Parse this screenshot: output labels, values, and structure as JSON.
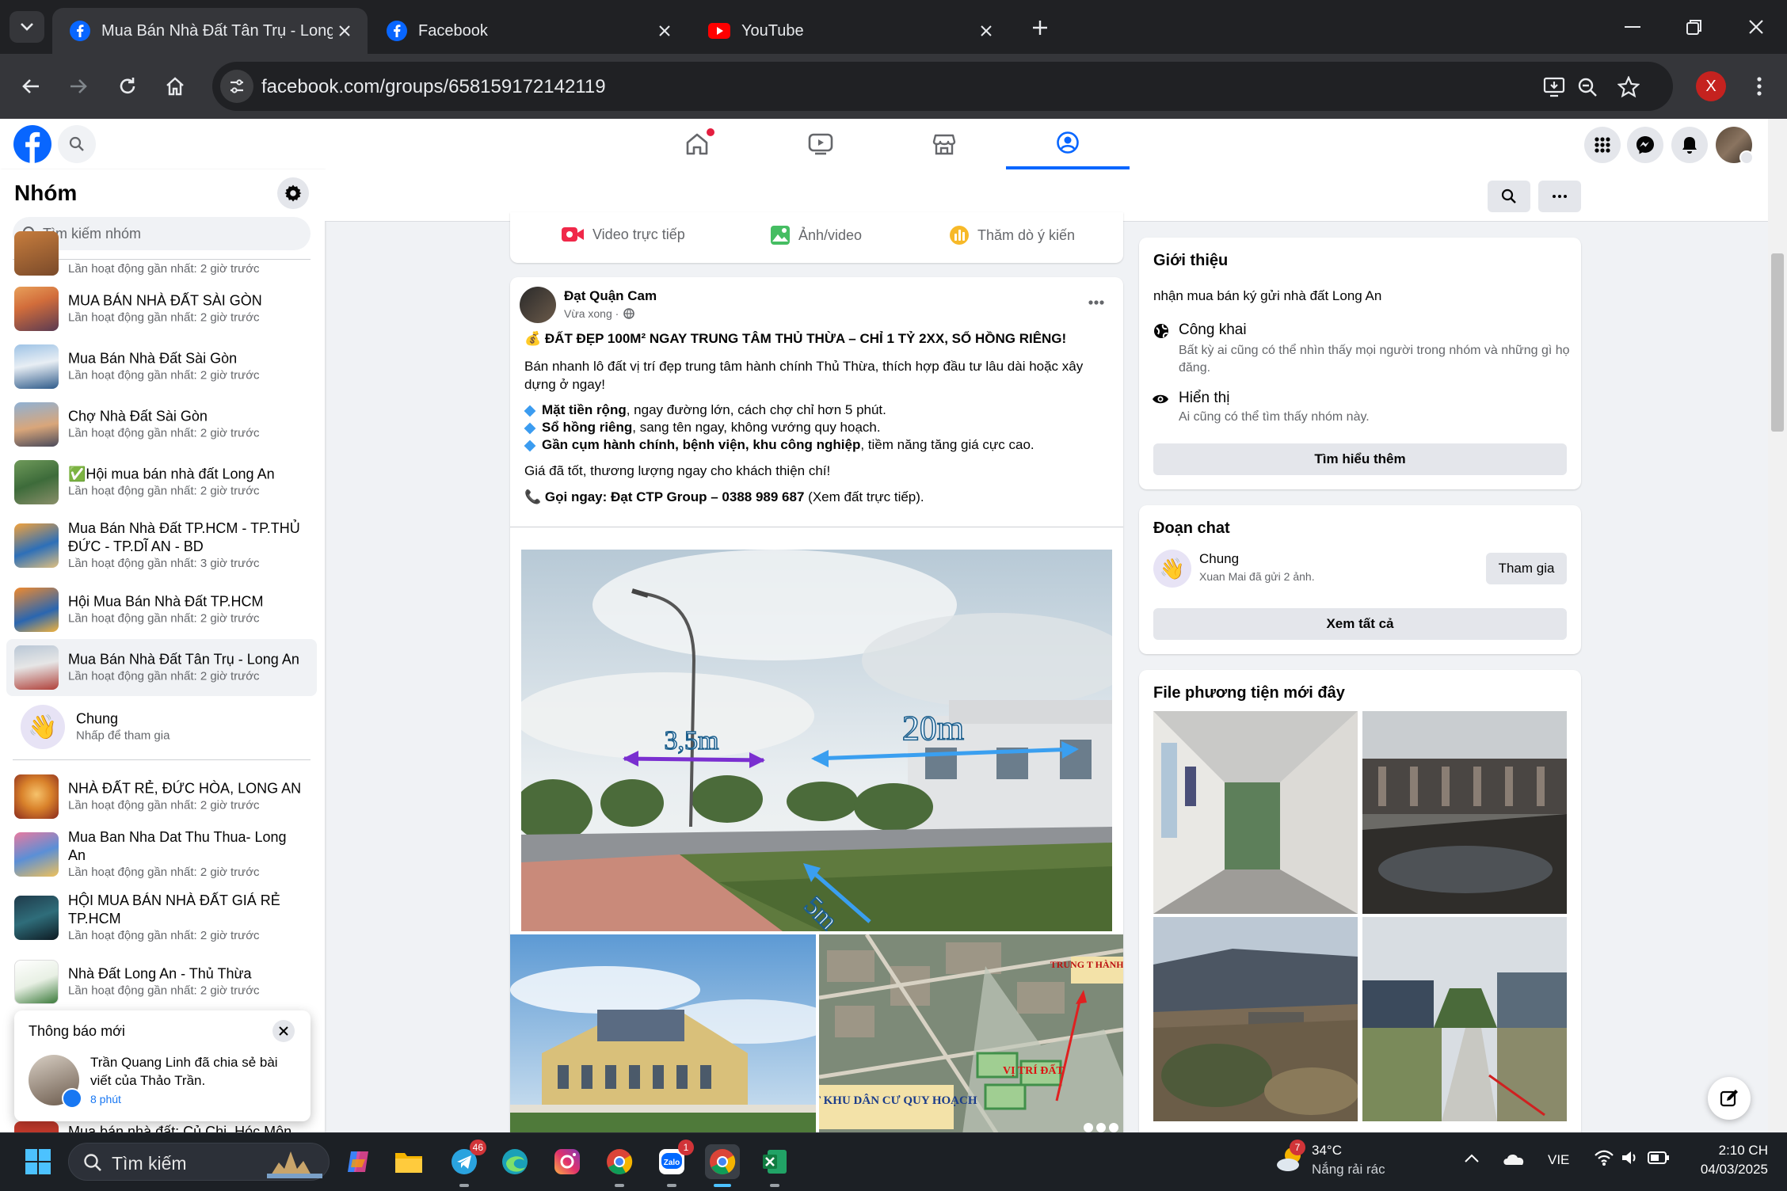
{
  "browser": {
    "tabs": [
      {
        "title": "Mua Bán Nhà Đất Tân Trụ - Long A",
        "active": true,
        "icon": "facebook-icon"
      },
      {
        "title": "Facebook",
        "active": false,
        "icon": "facebook-icon"
      },
      {
        "title": "YouTube",
        "active": false,
        "icon": "youtube-icon"
      }
    ],
    "url": "facebook.com/groups/658159172142119",
    "profile_initial": "X"
  },
  "sidebar": {
    "title": "Nhóm",
    "search_placeholder": "Tìm kiếm nhóm",
    "top_partial_activity": "Lần hoạt động gần nhất: 2 giờ trước",
    "groups": [
      {
        "name": "MUA BÁN NHÀ ĐẤT SÀI GÒN",
        "activity": "Lần hoạt động gần nhất: 2 giờ trước"
      },
      {
        "name": "Mua Bán Nhà Đất Sài Gòn",
        "activity": "Lần hoạt động gần nhất: 2 giờ trước"
      },
      {
        "name": "Chợ Nhà Đất Sài Gòn",
        "activity": "Lần hoạt động gần nhất: 2 giờ trước"
      },
      {
        "name": "✅Hội mua bán nhà đất Long An",
        "activity": "Lần hoạt động gần nhất: 2 giờ trước"
      },
      {
        "name": "Mua Bán Nhà Đất TP.HCM - TP.THỦ ĐỨC - TP.DĨ AN - BD",
        "activity": "Lần hoạt động gần nhất: 3 giờ trước"
      },
      {
        "name": "Hội Mua Bán Nhà Đất TP.HCM",
        "activity": "Lần hoạt động gần nhất: 2 giờ trước"
      },
      {
        "name": "Mua Bán Nhà Đất Tân Trụ - Long An",
        "activity": "Lần hoạt động gần nhất: 2 giờ trước"
      }
    ],
    "chat": {
      "name": "Chung",
      "hint": "Nhấp để tham gia"
    },
    "groups2": [
      {
        "name": "NHÀ ĐẤT RẺ, ĐỨC HÒA, LONG AN",
        "activity": "Lần hoạt động gần nhất: 2 giờ trước"
      },
      {
        "name": "Mua Ban Nha Dat Thu Thua- Long An",
        "activity": "Lần hoạt động gần nhất: 2 giờ trước"
      },
      {
        "name": "HỘI MUA BÁN NHÀ ĐẤT GIÁ RẺ TP.HCM",
        "activity": "Lần hoạt động gần nhất: 2 giờ trước"
      },
      {
        "name": "Nhà Đất Long An - Thủ Thừa",
        "activity": "Lần hoạt động gần nhất: 2 giờ trước"
      }
    ],
    "bottom_partial": "Mua bán nhà đất: Củ Chi, Hóc Môn"
  },
  "notification": {
    "title": "Thông báo mới",
    "actor": "Trần Quang Linh",
    "action": " đã chia sẻ bài viết của ",
    "target": "Thảo Trần",
    "end": ".",
    "time": "8 phút"
  },
  "composer": {
    "live": "Video trực tiếp",
    "photo": "Ảnh/video",
    "poll": "Thăm dò ý kiến"
  },
  "post": {
    "author": "Đạt Quận Cam",
    "time": "Vừa xong ·",
    "headline": "💰 ĐẤT ĐẸP 100M² NGAY TRUNG TÂM THỦ THỪA – CHỈ 1 TỶ 2XX, SỔ HỒNG RIÊNG!",
    "intro": "Bán nhanh lô đất vị trí đẹp trung tâm hành chính Thủ Thừa, thích hợp đầu tư lâu dài hoặc xây dựng ở ngay!",
    "bullets": [
      {
        "bold": "Mặt tiền rộng",
        "rest": ", ngay đường lớn, cách chợ chỉ hơn 5 phút."
      },
      {
        "bold": "Sổ hồng riêng",
        "rest": ", sang tên ngay, không vướng quy hoạch."
      },
      {
        "bold": "Gần cụm hành chính, bệnh viện, khu công nghiệp",
        "rest": ", tiềm năng tăng giá cực cao."
      }
    ],
    "price_line": "Giá đã tốt, thương lượng ngay cho khách thiện chí!",
    "call_bold": "📞 Gọi ngay: Đạt CTP Group – 0388 989 687",
    "call_rest": " (Xem đất trực tiếp).",
    "image_labels": {
      "width": "3,5m",
      "length": "20m",
      "side": "5m"
    },
    "map_labels": {
      "top": "TRUNG T HÀNH CHÍ",
      "bottom": "ĐẤT KHU DÂN CƯ QUY HOẠCH",
      "marker": "VỊ TRÍ ĐẤT"
    }
  },
  "about": {
    "title": "Giới thiệu",
    "description": "nhận mua bán ký gửi nhà đất Long An",
    "public_title": "Công khai",
    "public_desc": "Bất kỳ ai cũng có thể nhìn thấy mọi người trong nhóm và những gì họ đăng.",
    "visible_title": "Hiển thị",
    "visible_desc": "Ai cũng có thể tìm thấy nhóm này.",
    "learn_more": "Tìm hiểu thêm"
  },
  "chats": {
    "title": "Đoạn chat",
    "name": "Chung",
    "sub": "Xuan Mai đã gửi 2 ảnh.",
    "join": "Tham gia",
    "see_all": "Xem tất cả"
  },
  "media": {
    "title": "File phương tiện mới đây"
  },
  "taskbar": {
    "search": "Tìm kiếm",
    "telegram_badge": "46",
    "zalo_badge": "1",
    "weather_badge": "7",
    "temp": "34°C",
    "weather": "Nắng rải rác",
    "lang": "VIE",
    "time": "2:10 CH",
    "date": "04/03/2025"
  }
}
